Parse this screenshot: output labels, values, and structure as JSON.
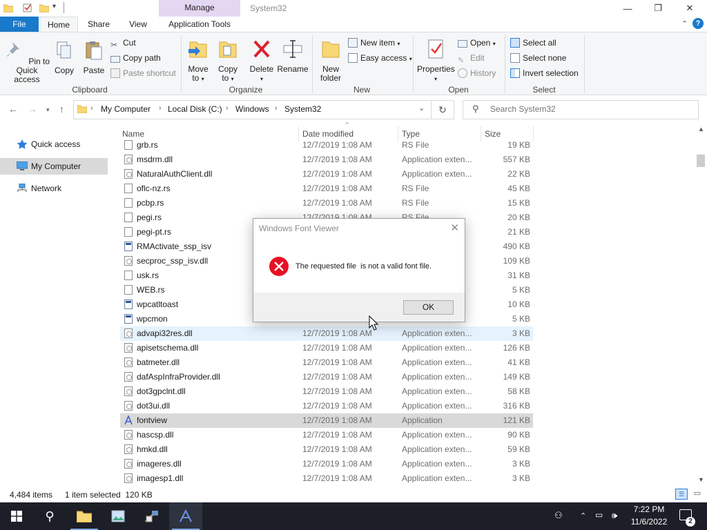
{
  "window": {
    "title": "System32",
    "contextual_tab_group": "Manage",
    "accent": "#1979ca",
    "manage_color": "#e4d7f2"
  },
  "tabs": [
    {
      "label": "File"
    },
    {
      "label": "Home"
    },
    {
      "label": "Share"
    },
    {
      "label": "View"
    },
    {
      "label": "Application Tools"
    }
  ],
  "ribbon": {
    "clipboard": {
      "group_label": "Clipboard",
      "pin": "Pin to Quick access",
      "pin_line1": "Pin to Quick",
      "pin_line2": "access",
      "copy": "Copy",
      "paste": "Paste",
      "cut": "Cut",
      "copy_path": "Copy path",
      "paste_shortcut": "Paste shortcut"
    },
    "organize": {
      "group_label": "Organize",
      "move_to_1": "Move",
      "move_to_2": "to",
      "copy_to_1": "Copy",
      "copy_to_2": "to",
      "delete": "Delete",
      "rename": "Rename"
    },
    "new": {
      "group_label": "New",
      "new_folder_1": "New",
      "new_folder_2": "folder",
      "new_item": "New item",
      "easy_access": "Easy access"
    },
    "open": {
      "group_label": "Open",
      "properties": "Properties",
      "open": "Open",
      "edit": "Edit",
      "history": "History"
    },
    "select": {
      "group_label": "Select",
      "select_all": "Select all",
      "select_none": "Select none",
      "invert_selection": "Invert selection"
    }
  },
  "address": {
    "crumbs": [
      "My Computer",
      "Local Disk (C:)",
      "Windows",
      "System32"
    ],
    "search_placeholder": "Search System32"
  },
  "nav_pane": [
    {
      "label": "Quick access",
      "icon": "star-icon"
    },
    {
      "label": "My Computer",
      "icon": "computer-icon"
    },
    {
      "label": "Network",
      "icon": "network-icon"
    }
  ],
  "columns": {
    "name": "Name",
    "date": "Date modified",
    "type": "Type",
    "size": "Size"
  },
  "files": [
    {
      "name": "grb.rs",
      "date": "12/7/2019 1:08 AM",
      "type": "RS File",
      "size": "19 KB",
      "icon": "file-icon"
    },
    {
      "name": "msdrm.dll",
      "date": "12/7/2019 1:08 AM",
      "type": "Application exten...",
      "size": "557 KB",
      "icon": "dll-icon"
    },
    {
      "name": "NaturalAuthClient.dll",
      "date": "12/7/2019 1:08 AM",
      "type": "Application exten...",
      "size": "22 KB",
      "icon": "dll-icon"
    },
    {
      "name": "oflc-nz.rs",
      "date": "12/7/2019 1:08 AM",
      "type": "RS File",
      "size": "45 KB",
      "icon": "file-icon"
    },
    {
      "name": "pcbp.rs",
      "date": "12/7/2019 1:08 AM",
      "type": "RS File",
      "size": "15 KB",
      "icon": "file-icon"
    },
    {
      "name": "pegi.rs",
      "date": "12/7/2019 1:08 AM",
      "type": "RS File",
      "size": "20 KB",
      "icon": "file-icon"
    },
    {
      "name": "pegi-pt.rs",
      "date": "",
      "type": "",
      "size": "21 KB",
      "icon": "file-icon"
    },
    {
      "name": "RMActivate_ssp_isv",
      "date": "",
      "type": "",
      "size": "490 KB",
      "icon": "app-icon"
    },
    {
      "name": "secproc_ssp_isv.dll",
      "date": "",
      "type": "",
      "size": "109 KB",
      "icon": "dll-icon"
    },
    {
      "name": "usk.rs",
      "date": "",
      "type": "",
      "size": "31 KB",
      "icon": "file-icon"
    },
    {
      "name": "WEB.rs",
      "date": "",
      "type": "",
      "size": "5 KB",
      "icon": "file-icon"
    },
    {
      "name": "wpcatltoast",
      "date": "",
      "type": "",
      "size": "10 KB",
      "icon": "app-icon"
    },
    {
      "name": "wpcmon",
      "date": "",
      "type": "",
      "size": "5 KB",
      "icon": "app-icon"
    },
    {
      "name": "advapi32res.dll",
      "date": "12/7/2019 1:08 AM",
      "type": "Application exten...",
      "size": "3 KB",
      "icon": "dll-icon",
      "state": "hover"
    },
    {
      "name": "apisetschema.dll",
      "date": "12/7/2019 1:08 AM",
      "type": "Application exten...",
      "size": "126 KB",
      "icon": "dll-icon"
    },
    {
      "name": "batmeter.dll",
      "date": "12/7/2019 1:08 AM",
      "type": "Application exten...",
      "size": "41 KB",
      "icon": "dll-icon"
    },
    {
      "name": "dafAspInfraProvider.dll",
      "date": "12/7/2019 1:08 AM",
      "type": "Application exten...",
      "size": "149 KB",
      "icon": "dll-icon"
    },
    {
      "name": "dot3gpclnt.dll",
      "date": "12/7/2019 1:08 AM",
      "type": "Application exten...",
      "size": "58 KB",
      "icon": "dll-icon"
    },
    {
      "name": "dot3ui.dll",
      "date": "12/7/2019 1:08 AM",
      "type": "Application exten...",
      "size": "316 KB",
      "icon": "dll-icon"
    },
    {
      "name": "fontview",
      "date": "12/7/2019 1:08 AM",
      "type": "Application",
      "size": "121 KB",
      "icon": "fontview-icon",
      "state": "selected"
    },
    {
      "name": "hascsp.dll",
      "date": "12/7/2019 1:08 AM",
      "type": "Application exten...",
      "size": "90 KB",
      "icon": "dll-icon"
    },
    {
      "name": "hmkd.dll",
      "date": "12/7/2019 1:08 AM",
      "type": "Application exten...",
      "size": "59 KB",
      "icon": "dll-icon"
    },
    {
      "name": "imageres.dll",
      "date": "12/7/2019 1:08 AM",
      "type": "Application exten...",
      "size": "3 KB",
      "icon": "dll-icon"
    },
    {
      "name": "imagesp1.dll",
      "date": "12/7/2019 1:08 AM",
      "type": "Application exten...",
      "size": "3 KB",
      "icon": "dll-icon"
    }
  ],
  "status": {
    "items": "4,484 items",
    "selected": "1 item selected  120 KB"
  },
  "dialog": {
    "title": "Windows Font Viewer",
    "message": "The requested file  is not a valid font file.",
    "ok": "OK",
    "error_color": "#e81123"
  },
  "taskbar": {
    "time": "7:22 PM",
    "date": "11/6/2022",
    "notification_count": "2",
    "bg": "#1c1f27"
  }
}
